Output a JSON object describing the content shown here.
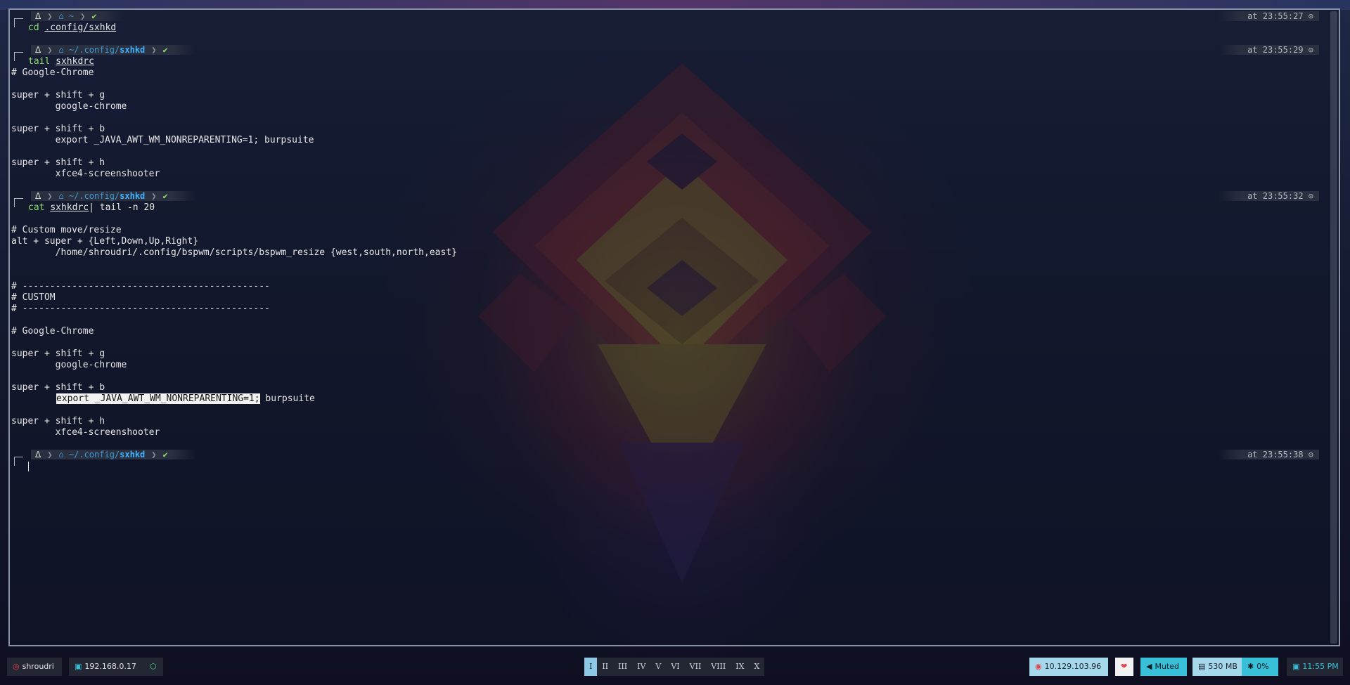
{
  "terminal": {
    "blocks": [
      {
        "prompt": {
          "os_icon": "ᐃ",
          "dir_prefix": "~",
          "dir_bold": "",
          "status": "✔",
          "time": "at 23:55:27 ⊙"
        },
        "command": {
          "verb": "cd",
          "arg": ".config/sxhkd",
          "rest": ""
        },
        "output": []
      },
      {
        "prompt": {
          "os_icon": "ᐃ",
          "dir_prefix": "~/.config/",
          "dir_bold": "sxhkd",
          "status": "✔",
          "time": "at 23:55:29 ⊙"
        },
        "command": {
          "verb": "tail",
          "arg": "sxhkdrc",
          "rest": ""
        },
        "output": [
          "# Google-Chrome",
          "",
          "super + shift + g",
          "        google-chrome",
          "",
          "super + shift + b",
          "        export _JAVA_AWT_WM_NONREPARENTING=1; burpsuite",
          "",
          "super + shift + h",
          "        xfce4-screenshooter"
        ]
      },
      {
        "prompt": {
          "os_icon": "ᐃ",
          "dir_prefix": "~/.config/",
          "dir_bold": "sxhkd",
          "status": "✔",
          "time": "at 23:55:32 ⊙"
        },
        "command": {
          "verb": "cat",
          "arg": "sxhkdrc",
          "rest": "| tail -n 20"
        },
        "output": [
          "",
          "# Custom move/resize",
          "alt + super + {Left,Down,Up,Right}",
          "        /home/shroudri/.config/bspwm/scripts/bspwm_resize {west,south,north,east}",
          "",
          "",
          "# ---------------------------------------------",
          "# CUSTOM",
          "# ---------------------------------------------",
          "",
          "# Google-Chrome",
          "",
          "super + shift + g",
          "        google-chrome",
          "",
          "super + shift + b",
          "        export _JAVA_AWT_WM_NONREPARENTING=1; burpsuite",
          "",
          "super + shift + h",
          "        xfce4-screenshooter"
        ],
        "selection": {
          "line_index": 16,
          "selected_text": "export _JAVA_AWT_WM_NONREPARENTING=1;",
          "after_text": " burpsuite"
        }
      },
      {
        "prompt": {
          "os_icon": "ᐃ",
          "dir_prefix": "~/.config/",
          "dir_bold": "sxhkd",
          "status": "✔",
          "time": "at 23:55:38 ⊙"
        },
        "command": {
          "verb": "",
          "arg": "",
          "rest": ""
        },
        "output": [],
        "cursor": true
      }
    ]
  },
  "bar": {
    "user": {
      "icon": "bug-icon",
      "label": "shroudri"
    },
    "local_ip": {
      "icon": "ethernet-icon",
      "label": "192.168.0.17"
    },
    "cube_icon": "cube-icon",
    "workspaces": [
      "I",
      "II",
      "III",
      "IV",
      "V",
      "VI",
      "VII",
      "VIII",
      "IX",
      "X"
    ],
    "active_workspace": "I",
    "target_ip": {
      "icon": "target-icon",
      "label": "10.129.103.96"
    },
    "heart": "❤",
    "volume": {
      "icon": "speaker-icon",
      "label": "Muted"
    },
    "memory": {
      "icon": "memory-icon",
      "label": "530 MB"
    },
    "cpu": {
      "icon": "cpu-icon",
      "label": "0%"
    },
    "clock": {
      "icon": "clock-icon",
      "label": "11:55 PM"
    },
    "colors": {
      "accent": "#8cc9e6",
      "cyan": "#37c0d8",
      "target_red": "#e8424a"
    }
  }
}
